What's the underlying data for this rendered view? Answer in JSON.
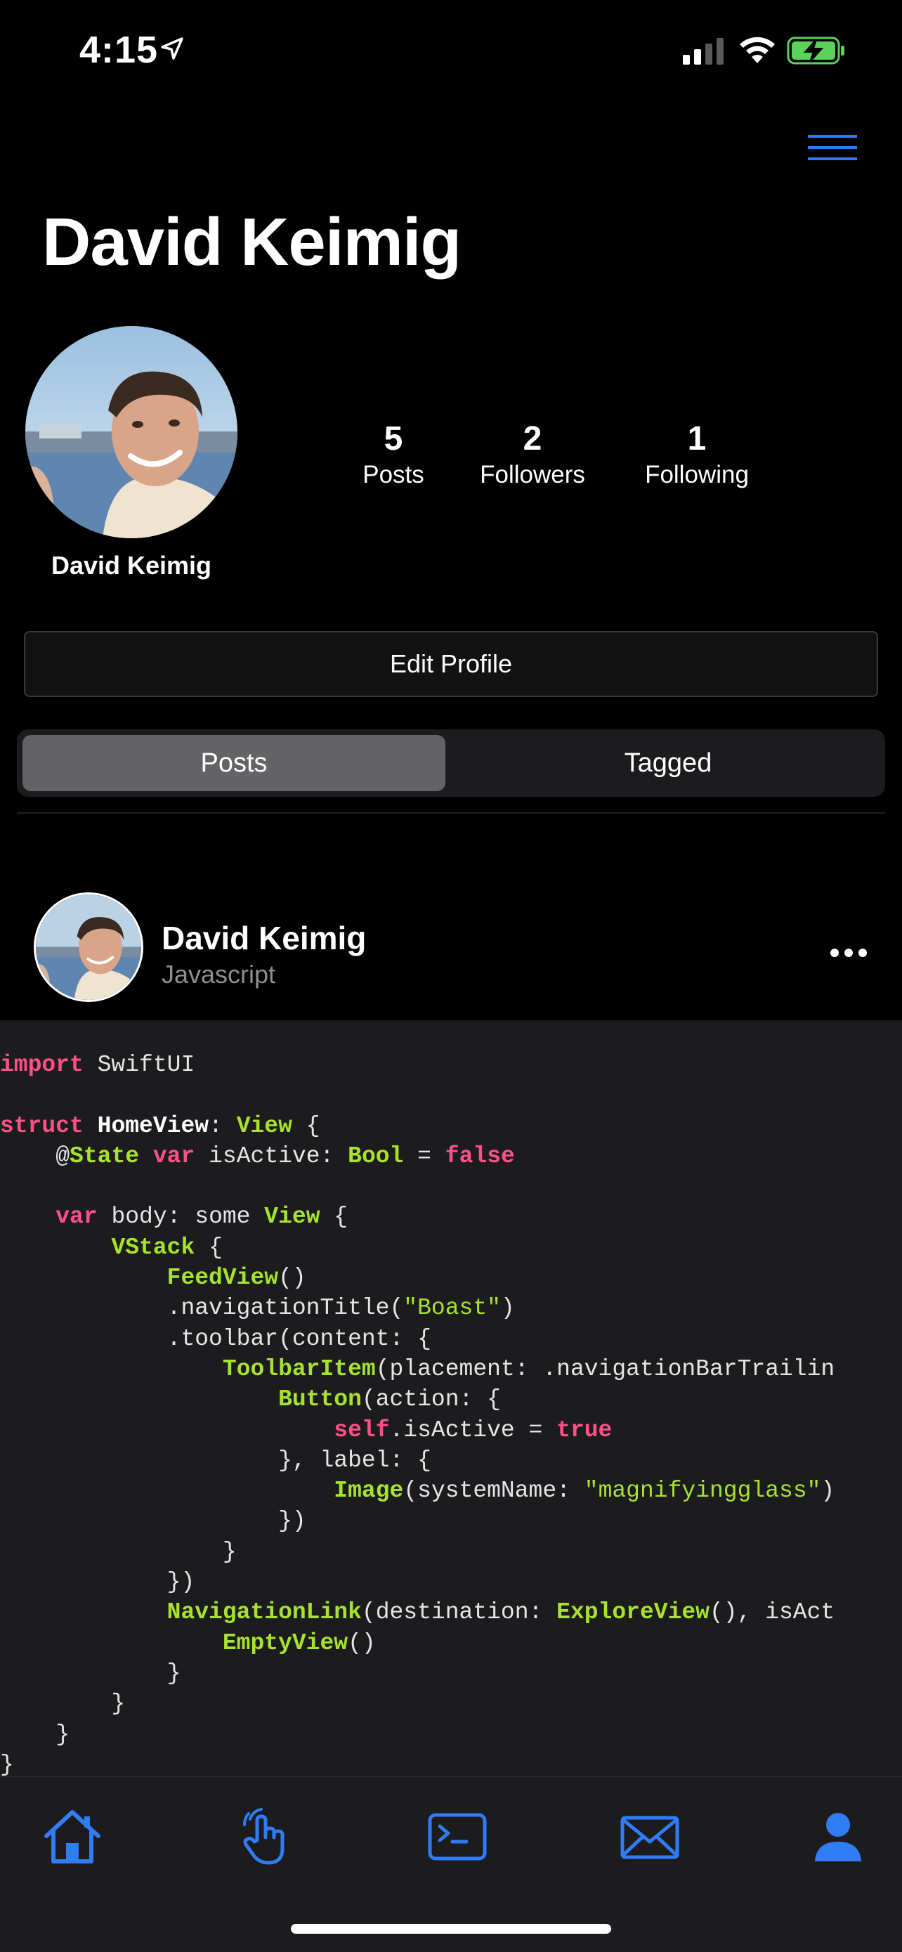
{
  "status_bar": {
    "time": "4:15"
  },
  "title": "David Keimig",
  "profile": {
    "name": "David Keimig",
    "stats": [
      {
        "value": "5",
        "label": "Posts"
      },
      {
        "value": "2",
        "label": "Followers"
      },
      {
        "value": "1",
        "label": "Following"
      }
    ],
    "edit_button": "Edit Profile"
  },
  "segments": {
    "posts": "Posts",
    "tagged": "Tagged",
    "selected": "Posts"
  },
  "post": {
    "author": "David Keimig",
    "language": "Javascript"
  },
  "code_lines": [
    "import SwiftUI",
    "",
    "struct HomeView: View {",
    "    @State var isActive: Bool = false",
    "",
    "    var body: some View {",
    "        VStack {",
    "            FeedView()",
    "            .navigationTitle(\"Boast\")",
    "            .toolbar(content: {",
    "                ToolbarItem(placement: .navigationBarTrailin",
    "                    Button(action: {",
    "                        self.isActive = true",
    "                    }, label: {",
    "                        Image(systemName: \"magnifyingglass\")",
    "                    })",
    "                }",
    "            })",
    "            NavigationLink(destination: ExploreView(), isAct",
    "                EmptyView()",
    "            }",
    "        }",
    "    }",
    "}"
  ],
  "tab_bar": {
    "icons": [
      "house-icon",
      "hand-tap-icon",
      "terminal-icon",
      "envelope-icon",
      "person-icon"
    ],
    "selected_icon": "person-icon"
  },
  "colors": {
    "accent": "#2f7cf6",
    "keyword": "#ff4f8b",
    "type": "#a6e22e",
    "background": "#000000",
    "code_background": "#1c1c1e"
  }
}
